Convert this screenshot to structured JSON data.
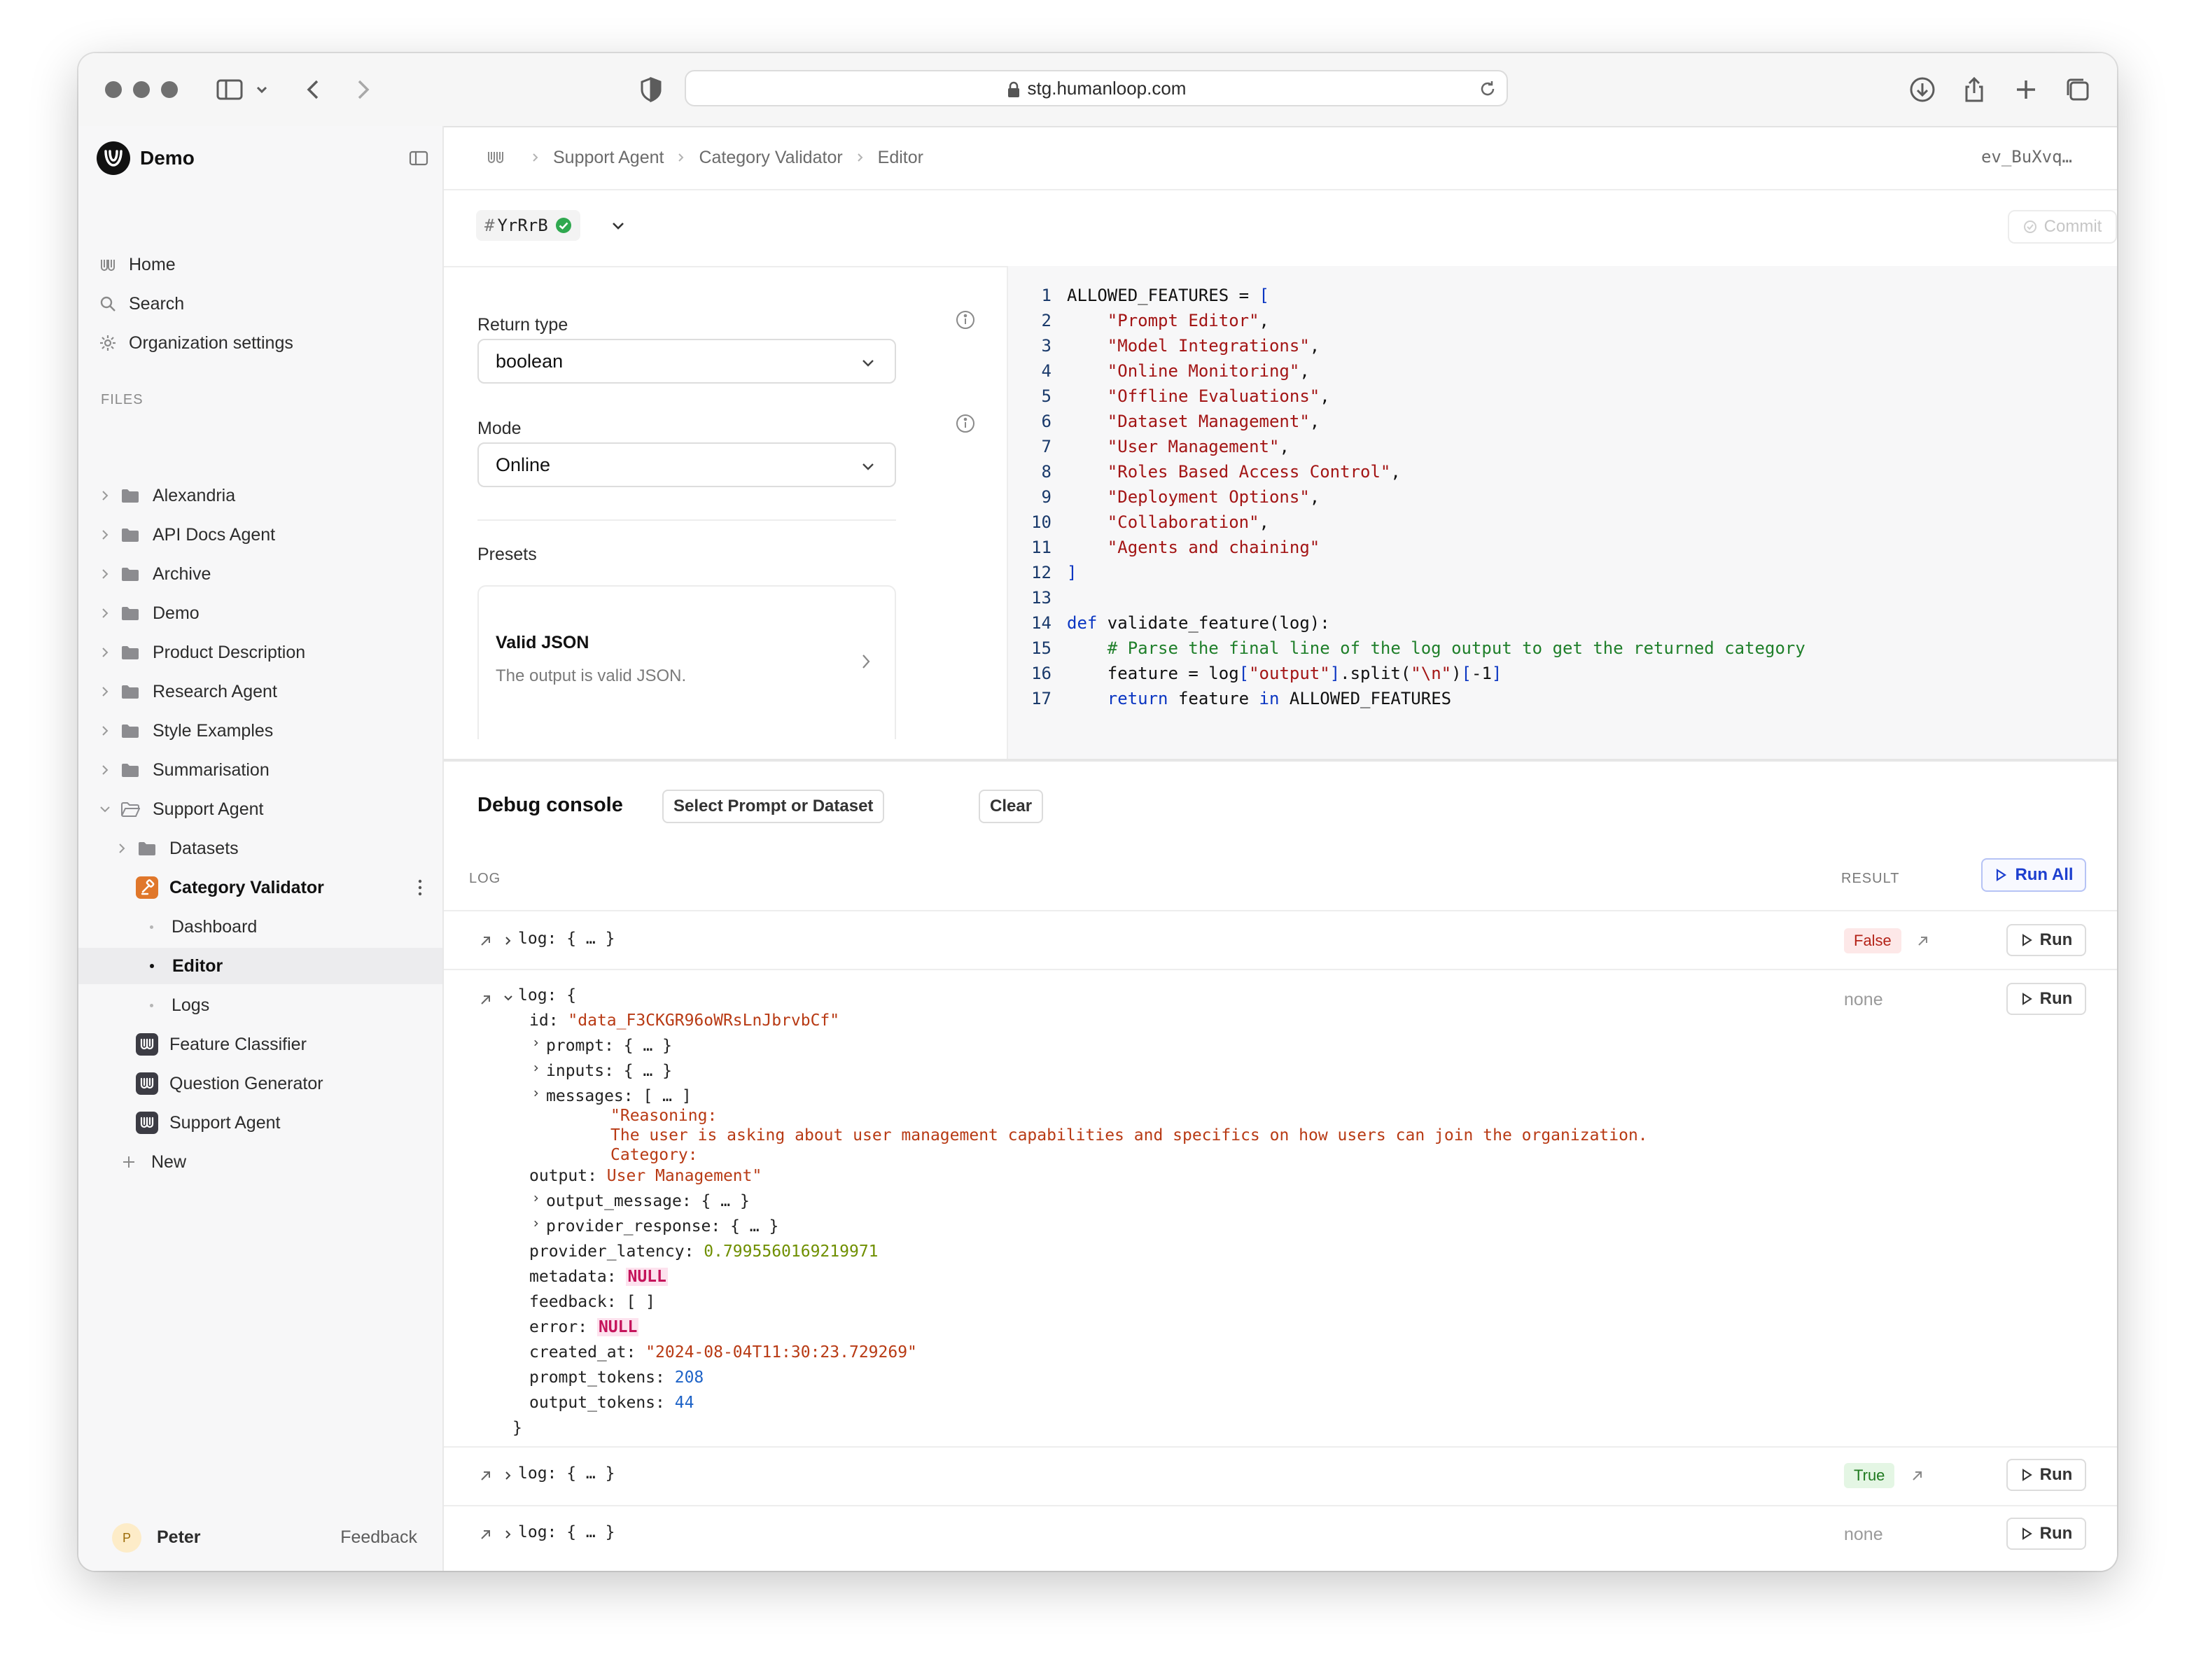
{
  "browser": {
    "url": "stg.humanloop.com"
  },
  "sidebar": {
    "workspace": "Demo",
    "nav": [
      {
        "label": "Home",
        "icon": "humanloop-icon"
      },
      {
        "label": "Search",
        "icon": "search-icon"
      },
      {
        "label": "Organization settings",
        "icon": "gear-icon"
      }
    ],
    "files_label": "FILES",
    "tree": [
      {
        "label": "Alexandria",
        "type": "folder"
      },
      {
        "label": "API Docs Agent",
        "type": "folder"
      },
      {
        "label": "Archive",
        "type": "folder"
      },
      {
        "label": "Demo",
        "type": "folder"
      },
      {
        "label": "Product Description",
        "type": "folder"
      },
      {
        "label": "Research Agent",
        "type": "folder"
      },
      {
        "label": "Style Examples",
        "type": "folder"
      },
      {
        "label": "Summarisation",
        "type": "folder"
      },
      {
        "label": "Support Agent",
        "type": "folder-open"
      },
      {
        "label": "Datasets",
        "type": "folder"
      },
      {
        "label": "Category Validator",
        "type": "evaluator"
      },
      {
        "label": "Dashboard",
        "type": "page"
      },
      {
        "label": "Editor",
        "type": "page",
        "active": true
      },
      {
        "label": "Logs",
        "type": "page"
      },
      {
        "label": "Feature Classifier",
        "type": "prompt"
      },
      {
        "label": "Question Generator",
        "type": "prompt"
      },
      {
        "label": "Support Agent",
        "type": "prompt"
      },
      {
        "label": "New",
        "type": "new"
      }
    ],
    "user": {
      "initial": "P",
      "name": "Peter"
    },
    "feedback": "Feedback"
  },
  "breadcrumb": {
    "items": [
      "Support Agent",
      "Category Validator",
      "Editor"
    ],
    "id": "ev_BuXvq…"
  },
  "version": {
    "hash": "YrRrB",
    "commit_label": "Commit"
  },
  "config": {
    "return_type_label": "Return type",
    "return_type_value": "boolean",
    "mode_label": "Mode",
    "mode_value": "Online",
    "presets_label": "Presets",
    "preset": {
      "title": "Valid JSON",
      "description": "The output is valid JSON."
    }
  },
  "code": {
    "lines": [
      "ALLOWED_FEATURES = [",
      "    \"Prompt Editor\",",
      "    \"Model Integrations\",",
      "    \"Online Monitoring\",",
      "    \"Offline Evaluations\",",
      "    \"Dataset Management\",",
      "    \"User Management\",",
      "    \"Roles Based Access Control\",",
      "    \"Deployment Options\",",
      "    \"Collaboration\",",
      "    \"Agents and chaining\"",
      "]",
      "",
      "def validate_feature(log):",
      "    # Parse the final line of the log output to get the returned category",
      "    feature = log[\"output\"].split(\"\\n\")[-1]",
      "    return feature in ALLOWED_FEATURES"
    ]
  },
  "debug": {
    "title": "Debug console",
    "select_label": "Select Prompt or Dataset",
    "clear_label": "Clear",
    "log_header": "LOG",
    "result_header": "RESULT",
    "run_all_label": "Run All",
    "run_label": "Run",
    "collapsed_log": "log: { … }",
    "rows": [
      {
        "result": "False"
      },
      {
        "result": "none"
      },
      {
        "result": "True"
      },
      {
        "result": "none"
      }
    ],
    "expanded": {
      "open": "log: {",
      "id_key": "id:",
      "id_val": "\"data_F3CKGR96oWRsLnJbrvbCf\"",
      "prompt": "prompt: { … }",
      "inputs": "inputs: { … }",
      "messages": "messages: [ … ]",
      "msg1": "\"Reasoning:",
      "msg2": "The user is asking about user management capabilities and specifics on how users can join the organization.",
      "msg3": "Category:",
      "output_key": "output:",
      "output_val": "User Management\"",
      "output_message": "output_message: { … }",
      "provider_response": "provider_response: { … }",
      "latency_key": "provider_latency:",
      "latency_val": "0.7995560169219971",
      "metadata_key": "metadata:",
      "null_val": "NULL",
      "feedback_line": "feedback: [ ]",
      "error_key": "error:",
      "created_key": "created_at:",
      "created_val": "\"2024-08-04T11:30:23.729269\"",
      "prompt_tokens_key": "prompt_tokens:",
      "prompt_tokens_val": "208",
      "output_tokens_key": "output_tokens:",
      "output_tokens_val": "44",
      "close": "}"
    }
  }
}
